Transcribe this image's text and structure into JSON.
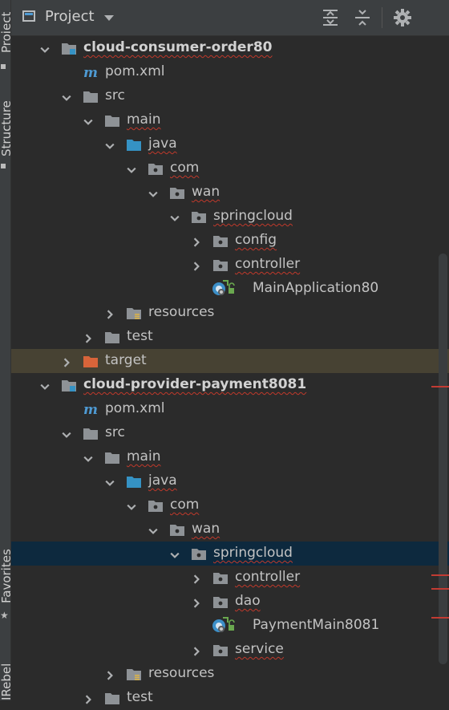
{
  "side_strip": {
    "tabs": [
      "Project",
      "Structure",
      "Favorites",
      "JRebel"
    ]
  },
  "header": {
    "title": "Project",
    "icons": [
      "project-view-icon",
      "dropdown-icon",
      "expand-all-icon",
      "collapse-all-icon",
      "gear-icon"
    ]
  },
  "tree": [
    {
      "label": "cloud-consumer-order80",
      "type": "module",
      "expanded": true,
      "depth": 1
    },
    {
      "label": "pom.xml",
      "type": "maven",
      "depth": 2
    },
    {
      "label": "src",
      "type": "folder",
      "expanded": true,
      "depth": 2
    },
    {
      "label": "main",
      "type": "folder",
      "expanded": true,
      "depth": 3
    },
    {
      "label": "java",
      "type": "source-folder",
      "expanded": true,
      "depth": 4
    },
    {
      "label": "com",
      "type": "package",
      "expanded": true,
      "depth": 5
    },
    {
      "label": "wan",
      "type": "package",
      "expanded": true,
      "depth": 6
    },
    {
      "label": "springcloud",
      "type": "package",
      "expanded": true,
      "depth": 7
    },
    {
      "label": "config",
      "type": "package",
      "expanded": false,
      "depth": 8
    },
    {
      "label": "controller",
      "type": "package",
      "expanded": false,
      "depth": 8
    },
    {
      "label": "MainApplication80",
      "type": "spring-class",
      "depth": 9
    },
    {
      "label": "resources",
      "type": "resources-folder",
      "expanded": false,
      "depth": 4
    },
    {
      "label": "test",
      "type": "folder",
      "expanded": false,
      "depth": 3
    },
    {
      "label": "target",
      "type": "excluded-folder",
      "expanded": false,
      "depth": 2
    },
    {
      "label": "cloud-provider-payment8081",
      "type": "module",
      "expanded": true,
      "depth": 1
    },
    {
      "label": "pom.xml",
      "type": "maven",
      "depth": 2
    },
    {
      "label": "src",
      "type": "folder",
      "expanded": true,
      "depth": 2
    },
    {
      "label": "main",
      "type": "folder",
      "expanded": true,
      "depth": 3
    },
    {
      "label": "java",
      "type": "source-folder",
      "expanded": true,
      "depth": 4
    },
    {
      "label": "com",
      "type": "package",
      "expanded": true,
      "depth": 5
    },
    {
      "label": "wan",
      "type": "package",
      "expanded": true,
      "depth": 6
    },
    {
      "label": "springcloud",
      "type": "package",
      "expanded": true,
      "depth": 7
    },
    {
      "label": "controller",
      "type": "package",
      "expanded": false,
      "depth": 8
    },
    {
      "label": "dao",
      "type": "package",
      "expanded": false,
      "depth": 8
    },
    {
      "label": "PaymentMain8081",
      "type": "spring-class",
      "depth": 9
    },
    {
      "label": "service",
      "type": "package",
      "expanded": false,
      "depth": 8
    },
    {
      "label": "resources",
      "type": "resources-folder",
      "expanded": false,
      "depth": 4
    },
    {
      "label": "test",
      "type": "folder",
      "expanded": false,
      "depth": 3
    }
  ],
  "colors": {
    "background": "#2b2b2b",
    "panel_header": "#3c3f41",
    "selected_row": "#0d293e",
    "target_row": "#474233",
    "folder": "#8e9296",
    "source_folder": "#3592c4",
    "excluded_folder": "#d8643a",
    "error_underline": "#c0392b"
  }
}
